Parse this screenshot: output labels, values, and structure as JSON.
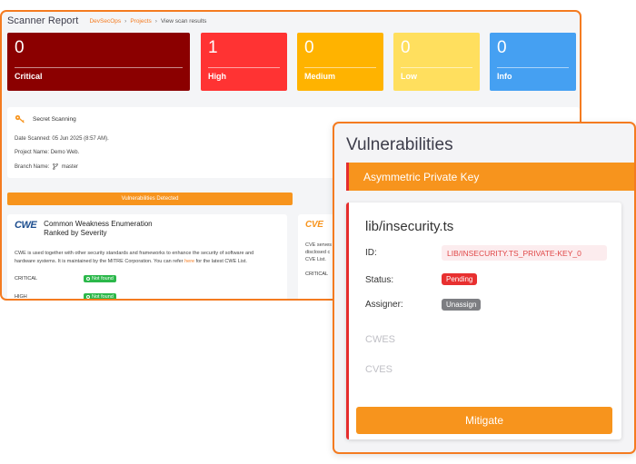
{
  "report": {
    "title": "Scanner Report",
    "breadcrumb": [
      "DevSecOps",
      "Projects",
      "View scan results"
    ],
    "cards": [
      {
        "count": "0",
        "label": "Critical",
        "color": "#8b0000"
      },
      {
        "count": "1",
        "label": "High",
        "color": "#ff3333"
      },
      {
        "count": "0",
        "label": "Medium",
        "color": "#ffb300"
      },
      {
        "count": "0",
        "label": "Low",
        "color": "#ffdf5e"
      },
      {
        "count": "0",
        "label": "Info",
        "color": "#45a0f2"
      }
    ],
    "scan_type": "Secret Scanning",
    "date_label": "Date Scanned:",
    "date_value": "05 Jun 2025 (8:57 AM).",
    "project_label": "Project Name:",
    "project_value": "Demo Web.",
    "branch_label": "Branch Name:",
    "branch_value": "master",
    "vuln_banner": "Vulnerabilities Detected",
    "cwe": {
      "logo": "CWE",
      "title_line1": "Common Weakness Enumeration",
      "title_line2": "Ranked by Severity",
      "desc_line1": "CWE is used together with other security standards and frameworks to enhance the security of software and",
      "desc_line2_pre": "hardware systems. It is maintained by the MITRE Corporation. You can refer",
      "desc_link": "here",
      "desc_line2_post": "for the latest CWE List.",
      "rows": [
        {
          "name": "CRITICAL",
          "badge": "Not found"
        },
        {
          "name": "HIGH",
          "badge": "Not found"
        }
      ]
    },
    "cve": {
      "logo": "CVE",
      "desc_line1": "CVE serves",
      "desc_line2": "disclosed c",
      "desc_line3": "CVE List.",
      "row": "CRITICAL"
    }
  },
  "vulnerabilities": {
    "title": "Vulnerabilities",
    "selected_item": "Asymmetric Private Key",
    "file": "lib/insecurity.ts",
    "id_label": "ID:",
    "id_value": "LIB/INSECURITY.TS_PRIVATE-KEY_0",
    "status_label": "Status:",
    "status_value": "Pending",
    "assigner_label": "Assigner:",
    "assigner_value": "Unassign",
    "cwes_label": "CWES",
    "cves_label": "CVES",
    "mitigate_label": "Mitigate"
  }
}
